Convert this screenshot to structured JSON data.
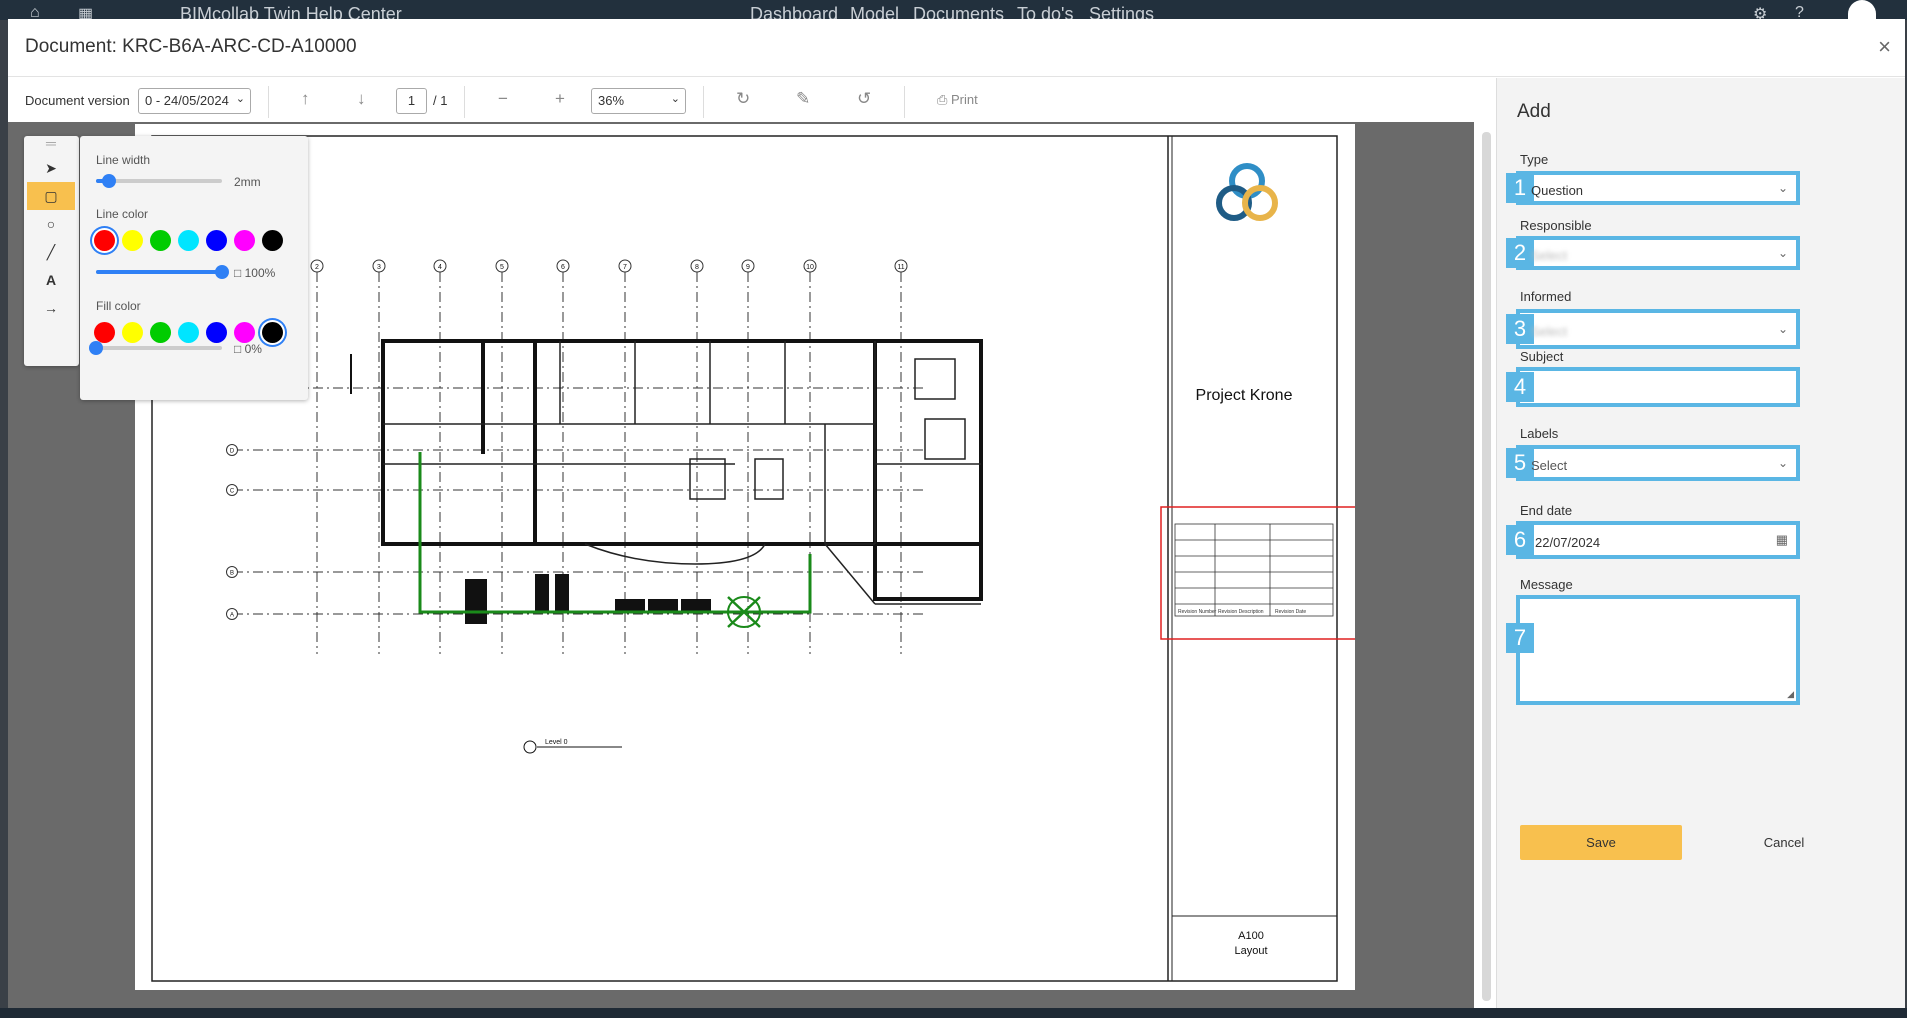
{
  "topnav": {
    "app_title": "BIMcollab Twin Help Center",
    "items": [
      "Dashboard",
      "Model",
      "Documents",
      "To do's",
      "Settings"
    ]
  },
  "modal": {
    "title": "Document: KRC-B6A-ARC-CD-A10000",
    "close": "×"
  },
  "toolbar": {
    "version_label": "Document version",
    "version_value": "0 - 24/05/2024",
    "page_current": "1",
    "page_total": "/ 1",
    "zoom_value": "36%",
    "print_label": "Print"
  },
  "draw_props": {
    "line_width_label": "Line width",
    "line_width_value": "2mm",
    "line_color_label": "Line color",
    "line_opacity": "100%",
    "fill_color_label": "Fill color",
    "fill_opacity": "0%",
    "line_width_level": 0.1,
    "line_opacity_level": 1.0,
    "fill_opacity_level": 0.0,
    "colors": [
      "#ff0000",
      "#ffff00",
      "#00cc00",
      "#00e5ff",
      "#0000ff",
      "#ff00ff",
      "#000000"
    ],
    "line_selected": "#ff0000",
    "fill_selected": "#000000"
  },
  "drawing": {
    "project_name": "Project Krone",
    "sheet_number": "A100",
    "sheet_name": "Layout",
    "level_label": "Level 0",
    "grid_numbers": [
      "2",
      "3",
      "4",
      "5",
      "6",
      "7",
      "8",
      "9",
      "10",
      "11"
    ],
    "grid_letters": [
      "E",
      "D",
      "C",
      "B",
      "A"
    ],
    "revision_headers": [
      "Revision Number",
      "Revision Description",
      "Revision Date"
    ]
  },
  "form": {
    "heading": "Add",
    "type_label": "Type",
    "type_value": "Question",
    "responsible_label": "Responsible",
    "responsible_value": "Select",
    "informed_label": "Informed",
    "informed_value": "Select",
    "subject_label": "Subject",
    "labels_label": "Labels",
    "labels_value": "Select",
    "end_date_label": "End date",
    "end_date_value": "22/07/2024",
    "message_label": "Message",
    "save_label": "Save",
    "cancel_label": "Cancel",
    "badges": [
      "1",
      "2",
      "3",
      "4",
      "5",
      "6",
      "7"
    ]
  }
}
